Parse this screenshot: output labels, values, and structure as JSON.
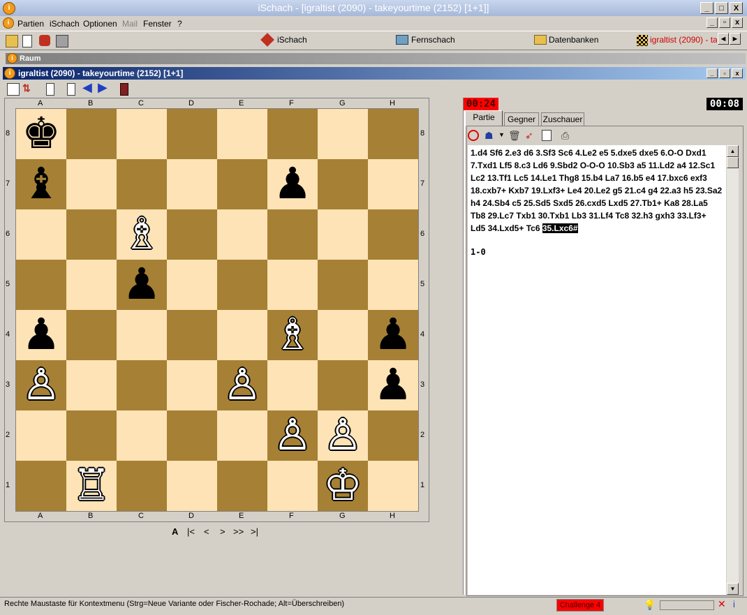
{
  "window": {
    "title": "iSchach - [igraltist (2090) - takeyourtime (2152)   [1+1]]",
    "min": "_",
    "max": "□",
    "close": "X"
  },
  "menu": [
    "Partien",
    "iSchach",
    "Optionen",
    "Mail",
    "Fenster",
    "?"
  ],
  "top_tabs": [
    "iSchach",
    "Fernschach",
    "Datenbanken",
    "igraltist (2090) - take"
  ],
  "top_tab_arrows": [
    "◄",
    "►"
  ],
  "raum": {
    "label": "Raum"
  },
  "child": {
    "title": "igraltist (2090) - takeyourtime (2152)  [1+1]"
  },
  "board": {
    "files": [
      "A",
      "B",
      "C",
      "D",
      "E",
      "F",
      "G",
      "H"
    ],
    "ranks": [
      "8",
      "7",
      "6",
      "5",
      "4",
      "3",
      "2",
      "1"
    ],
    "pieces": [
      {
        "sq": "a8",
        "glyph": "♚",
        "color": "b"
      },
      {
        "sq": "a7",
        "glyph": "♝",
        "color": "b"
      },
      {
        "sq": "f7",
        "glyph": "♟",
        "color": "b"
      },
      {
        "sq": "c6",
        "glyph": "♗",
        "color": "w"
      },
      {
        "sq": "c5",
        "glyph": "♟",
        "color": "b"
      },
      {
        "sq": "a4",
        "glyph": "♟",
        "color": "b"
      },
      {
        "sq": "f4",
        "glyph": "♗",
        "color": "w"
      },
      {
        "sq": "h4",
        "glyph": "♟",
        "color": "b"
      },
      {
        "sq": "a3",
        "glyph": "♙",
        "color": "w"
      },
      {
        "sq": "e3",
        "glyph": "♙",
        "color": "w"
      },
      {
        "sq": "h3",
        "glyph": "♟",
        "color": "b"
      },
      {
        "sq": "f2",
        "glyph": "♙",
        "color": "w"
      },
      {
        "sq": "g2",
        "glyph": "♙",
        "color": "w"
      },
      {
        "sq": "b1",
        "glyph": "♖",
        "color": "w"
      },
      {
        "sq": "g1",
        "glyph": "♔",
        "color": "w"
      }
    ],
    "light_color": "#fde3b5",
    "dark_color": "#a68034"
  },
  "nav": [
    "A",
    "|<",
    "<",
    ">",
    ">>",
    ">|"
  ],
  "clocks": {
    "left": "00:24",
    "right": "00:08"
  },
  "tabs": [
    "Partie",
    "Gegner",
    "Zuschauer"
  ],
  "notation": {
    "moves": "1.d4 Sf6 2.e3 d6 3.Sf3 Sc6 4.Le2 e5 5.dxe5 dxe5 6.O-O Dxd1 7.Txd1 Lf5 8.c3 Ld6 9.Sbd2 O-O-O 10.Sb3 a5 11.Ld2 a4 12.Sc1 Lc2 13.Tf1 Lc5 14.Le1 Thg8 15.b4 La7 16.b5 e4 17.bxc6 exf3 18.cxb7+ Kxb7 19.Lxf3+ Le4 20.Le2 g5 21.c4 g4 22.a3 h5 23.Sa2 h4 24.Sb4 c5 25.Sd5 Sxd5 26.cxd5 Lxd5 27.Tb1+ Ka8 28.La5 Tb8 29.Lc7 Txb1 30.Txb1 Lb3 31.Lf4 Tc8 32.h3 gxh3 33.Lf3+ Ld5 34.Lxd5+ Tc6 ",
    "last_move": "35.Lxc6#",
    "result": "1-0"
  },
  "status": {
    "text": "Rechte Maustaste für Kontextmenu (Strg=Neue Variante oder Fischer-Rochade; Alt=Überschreiben)",
    "challenge": "Challenge 4"
  }
}
